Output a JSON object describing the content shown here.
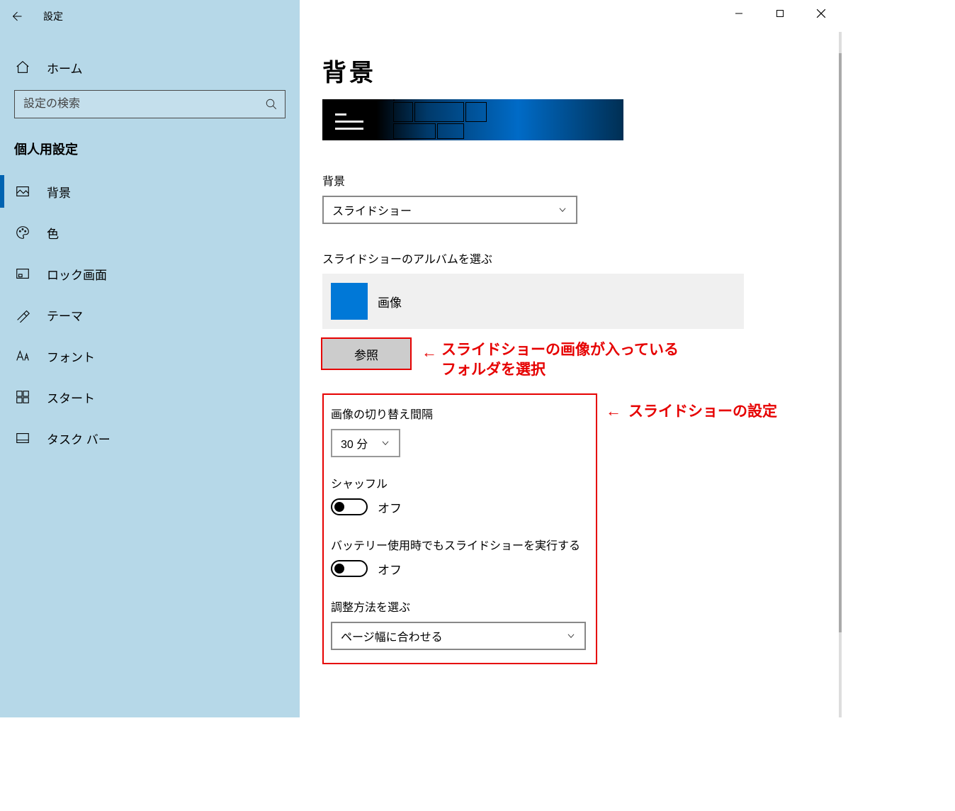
{
  "titlebar": {
    "title": "設定"
  },
  "sidebar": {
    "home_label": "ホーム",
    "search_placeholder": "設定の検索",
    "category_header": "個人用設定",
    "items": [
      {
        "id": "background",
        "label": "背景",
        "selected": true
      },
      {
        "id": "colors",
        "label": "色"
      },
      {
        "id": "lockscreen",
        "label": "ロック画面"
      },
      {
        "id": "themes",
        "label": "テーマ"
      },
      {
        "id": "fonts",
        "label": "フォント"
      },
      {
        "id": "start",
        "label": "スタート"
      },
      {
        "id": "taskbar",
        "label": "タスク バー"
      }
    ]
  },
  "content": {
    "heading": "背景",
    "background_select": {
      "label": "背景",
      "value": "スライドショー"
    },
    "album": {
      "label": "スライドショーのアルバムを選ぶ",
      "name": "画像"
    },
    "browse_button": "参照",
    "interval": {
      "label": "画像の切り替え間隔",
      "value": "30 分"
    },
    "shuffle": {
      "label": "シャッフル",
      "state_text": "オフ",
      "on": false
    },
    "battery": {
      "label": "バッテリー使用時でもスライドショーを実行する",
      "state_text": "オフ",
      "on": false
    },
    "fit": {
      "label": "調整方法を選ぶ",
      "value": "ページ幅に合わせる"
    }
  },
  "annotations": {
    "browse": "スライドショーの画像が入っている\nフォルダを選択",
    "settings": "スライドショーの設定"
  }
}
